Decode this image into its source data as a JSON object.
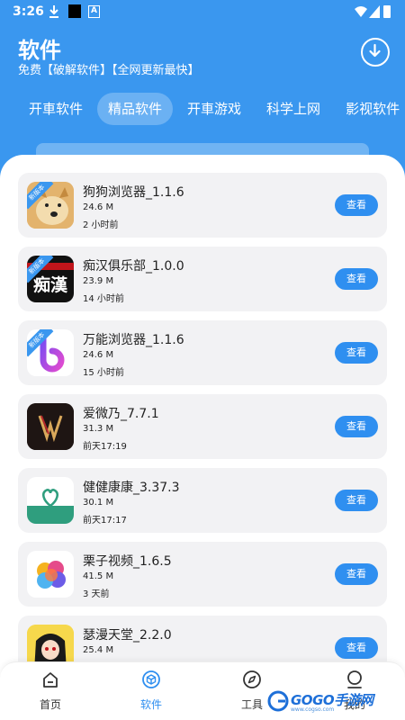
{
  "status": {
    "time": "3:26",
    "a_label": "A"
  },
  "header": {
    "title": "软件",
    "subtitle": "免费【破解软件】【全网更新最快】"
  },
  "tabs": [
    {
      "label": "开車软件",
      "active": false
    },
    {
      "label": "精品软件",
      "active": true
    },
    {
      "label": "开車游戏",
      "active": false
    },
    {
      "label": "科学上网",
      "active": false
    },
    {
      "label": "影视软件",
      "active": false
    }
  ],
  "apps": [
    {
      "name": "狗狗浏览器_1.1.6",
      "size": "24.6 M",
      "time": "2 小时前",
      "badge": "新版本",
      "icon": "doge-icon",
      "button": "查看"
    },
    {
      "name": "痴汉俱乐部_1.0.0",
      "size": "23.9 M",
      "time": "14 小时前",
      "badge": "新版本",
      "icon": "chihan-icon",
      "icon_text": "痴漢",
      "button": "查看"
    },
    {
      "name": "万能浏览器_1.1.6",
      "size": "24.6 M",
      "time": "15 小时前",
      "badge": "新版本",
      "icon": "b-logo-icon",
      "button": "查看"
    },
    {
      "name": "爱微乃_7.7.1",
      "size": "31.3 M",
      "time": "前天17:19",
      "badge": "",
      "icon": "w-logo-icon",
      "button": "查看"
    },
    {
      "name": "健健康康_3.37.3",
      "size": "30.1 M",
      "time": "前天17:17",
      "badge": "",
      "icon": "heart-icon",
      "button": "查看"
    },
    {
      "name": "栗子视频_1.6.5",
      "size": "41.5 M",
      "time": "3 天前",
      "badge": "",
      "icon": "colorful-blob-icon",
      "button": "查看"
    },
    {
      "name": "瑟漫天堂_2.2.0",
      "size": "25.4 M",
      "time": "",
      "badge": "",
      "icon": "anime-girl-icon",
      "button": "查看"
    }
  ],
  "nav": [
    {
      "label": "首页",
      "icon": "home-icon",
      "active": false
    },
    {
      "label": "软件",
      "icon": "cube-icon",
      "active": true
    },
    {
      "label": "工具",
      "icon": "compass-icon",
      "active": false
    },
    {
      "label": "我的",
      "icon": "person-icon",
      "active": false
    }
  ],
  "watermark": {
    "text": "GOGO手游网",
    "url": "www.cogso.com"
  },
  "colors": {
    "primary": "#3a97ef",
    "button": "#2f8ff0",
    "card": "#f2f2f4"
  }
}
